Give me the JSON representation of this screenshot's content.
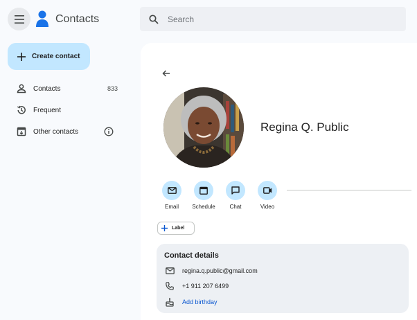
{
  "header": {
    "app_title": "Contacts",
    "menu_icon": "menu-icon",
    "logo": "contacts-logo",
    "search": {
      "placeholder": "Search",
      "value": ""
    }
  },
  "sidebar": {
    "create_label": "Create contact",
    "items": [
      {
        "label": "Contacts",
        "icon": "person-icon",
        "count": "833"
      },
      {
        "label": "Frequent",
        "icon": "history-icon"
      },
      {
        "label": "Other contacts",
        "icon": "archive-icon"
      }
    ]
  },
  "contact": {
    "name": "Regina Q. Public",
    "actions": [
      {
        "label": "Email",
        "icon": "mail-icon"
      },
      {
        "label": "Schedule",
        "icon": "calendar-icon"
      },
      {
        "label": "Chat",
        "icon": "chat-icon"
      },
      {
        "label": "Video",
        "icon": "video-icon"
      }
    ],
    "label_button": "Label",
    "details": {
      "title": "Contact details",
      "email": "regina.q.public@gmail.com",
      "phone": "+1 911 207 6499",
      "birthday_link": "Add birthday"
    }
  },
  "colors": {
    "accent": "#c2e7ff",
    "link": "#0b57d0",
    "card": "#edf0f4",
    "brand_blue": "#1a73e8"
  }
}
